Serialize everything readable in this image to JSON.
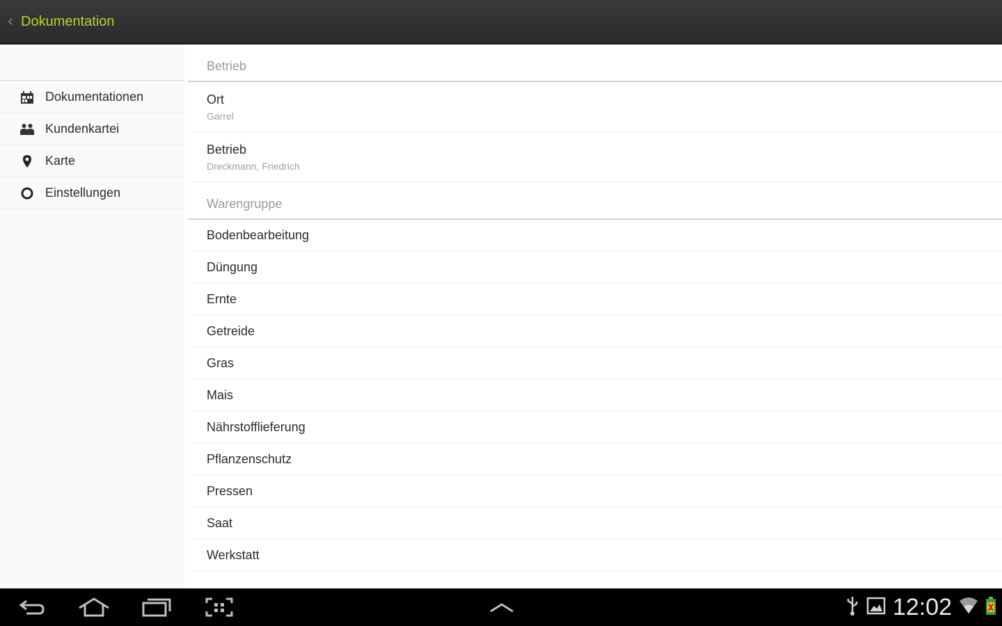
{
  "actionbar": {
    "title": "Dokumentation",
    "title_color": "#b9d32a",
    "up_icon": "chevron-left-icon"
  },
  "sidebar": {
    "items": [
      {
        "label": "Dokumentationen",
        "icon": "calendar-icon"
      },
      {
        "label": "Kundenkartei",
        "icon": "people-icon"
      },
      {
        "label": "Karte",
        "icon": "map-pin-icon"
      },
      {
        "label": "Einstellungen",
        "icon": "settings-circle-icon"
      }
    ]
  },
  "content": {
    "sections": [
      {
        "header": "Betrieb",
        "items": [
          {
            "primary": "Ort",
            "secondary": "Garrel"
          },
          {
            "primary": "Betrieb",
            "secondary": "Dreckmann, Friedrich"
          }
        ]
      },
      {
        "header": "Warengruppe",
        "items": [
          {
            "label": "Bodenbearbeitung"
          },
          {
            "label": "Düngung"
          },
          {
            "label": "Ernte"
          },
          {
            "label": "Getreide"
          },
          {
            "label": "Gras"
          },
          {
            "label": "Mais"
          },
          {
            "label": "Nährstofflieferung"
          },
          {
            "label": "Pflanzenschutz"
          },
          {
            "label": "Pressen"
          },
          {
            "label": "Saat"
          },
          {
            "label": "Werkstatt"
          }
        ]
      }
    ]
  },
  "system_bar": {
    "buttons": [
      "back-icon",
      "home-icon",
      "recent-apps-icon",
      "screenshot-icon",
      "chevron-up-icon"
    ],
    "status_icons": [
      "usb-icon",
      "picture-icon",
      "wifi-icon",
      "battery-icon"
    ],
    "time": "12:02"
  }
}
